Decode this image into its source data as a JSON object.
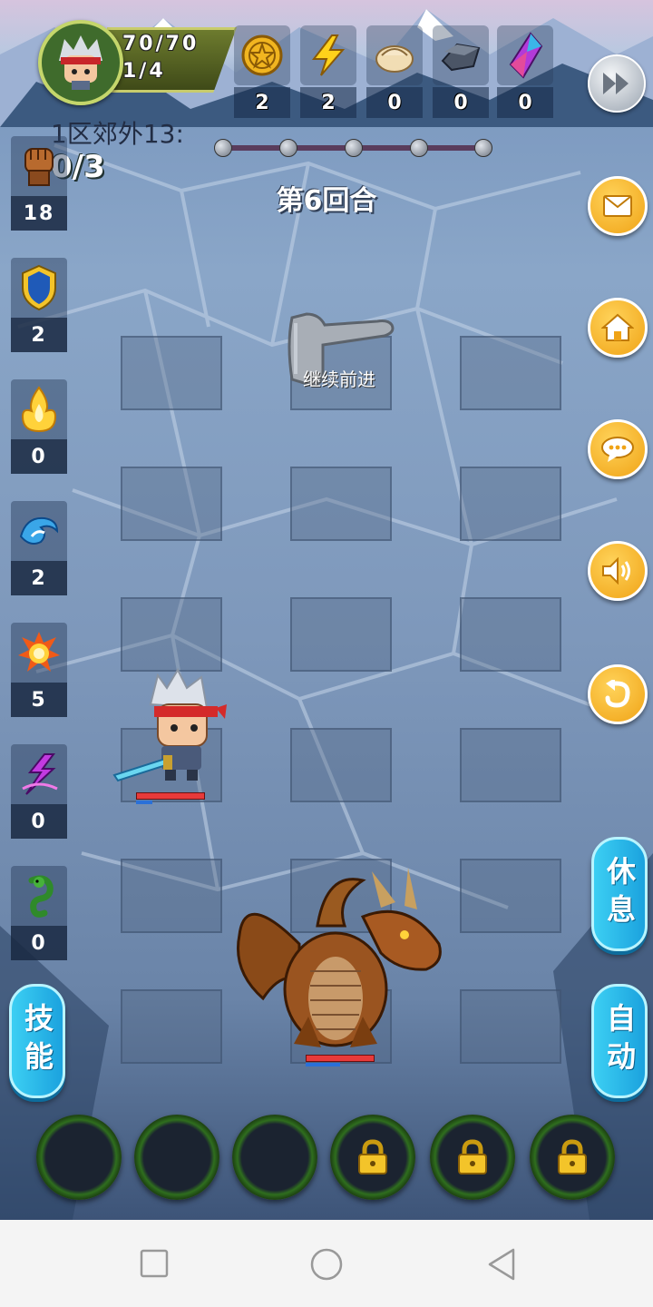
{
  "header": {
    "hp": "70/70",
    "level": "1/4",
    "resources": [
      {
        "icon": "gold-coin-icon",
        "count": "2"
      },
      {
        "icon": "lightning-icon",
        "count": "2"
      },
      {
        "icon": "dumpling-icon",
        "count": "0"
      },
      {
        "icon": "iron-ore-icon",
        "count": "0"
      },
      {
        "icon": "purple-crystal-icon",
        "count": "0"
      }
    ]
  },
  "stage": {
    "area": "1区郊外13:",
    "progress": "0/3",
    "round": "第6回合",
    "checkpoints_total": 5
  },
  "skills": [
    {
      "icon": "fist-icon",
      "count": "18"
    },
    {
      "icon": "shield-icon",
      "count": "2"
    },
    {
      "icon": "holy-flame-icon",
      "count": "0"
    },
    {
      "icon": "water-wave-icon",
      "count": "2"
    },
    {
      "icon": "fireball-icon",
      "count": "5"
    },
    {
      "icon": "lightning-rune-icon",
      "count": "0"
    },
    {
      "icon": "poison-serpent-icon",
      "count": "0"
    }
  ],
  "right_buttons": [
    "mail-icon",
    "home-icon",
    "chat-icon",
    "sound-icon",
    "undo-icon"
  ],
  "hint": {
    "text": "继续前进",
    "icon": "pointing-hand-icon"
  },
  "buttons": {
    "rest": "休息",
    "auto": "自动",
    "skills": "技能"
  },
  "skill_slots": [
    {
      "locked": false
    },
    {
      "locked": false
    },
    {
      "locked": false
    },
    {
      "locked": true
    },
    {
      "locked": true
    },
    {
      "locked": true
    }
  ],
  "hero": {
    "hp_fraction": 1.0
  },
  "enemy": {
    "name_icon": "brown-dragon-icon",
    "hp_fraction": 1.0
  },
  "colors": {
    "accent_orange": "#f0a316",
    "accent_cyan": "#1ba2de",
    "hp_red": "#e83a3a"
  }
}
